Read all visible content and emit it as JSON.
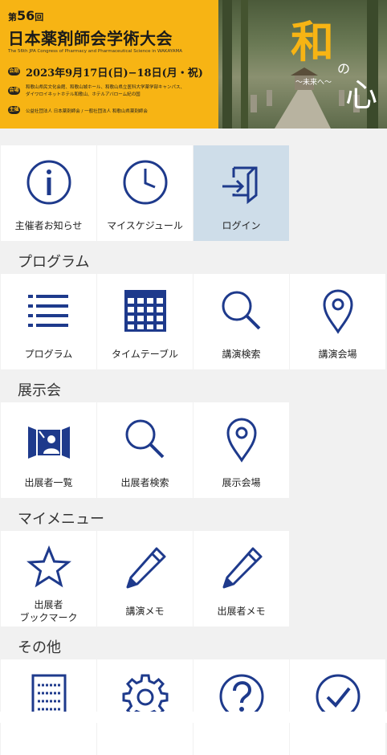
{
  "banner": {
    "edition_prefix": "第",
    "edition_number": "56",
    "edition_suffix": "回",
    "title": "日本薬剤師会学術大会",
    "subtitle": "The 56th JPA Congress of Pharmacy and Pharmaceutical Science in WAKAYAMA",
    "date_tag": "会期",
    "date": "2023年9月17日(日)−18日(月・祝)",
    "venue_tag": "会場",
    "venue_line1": "和歌山県民文化会館、和歌山城ホール、和歌山県立医科大学薬学部キャンパス、",
    "venue_line2": "ダイワロイネットホテル和歌山、ホテルアバローム紀の国",
    "host_tag": "主催",
    "host": "公益社団法人 日本薬剤師会 / 一般社団法人 和歌山県薬剤師会",
    "theme_wa": "和",
    "theme_no": "の",
    "theme_kokoro": "心",
    "theme_sub": "〜未来へ〜"
  },
  "top_tiles": [
    {
      "label": "主催者お知らせ",
      "icon": "info-icon"
    },
    {
      "label": "マイスケジュール",
      "icon": "clock-icon"
    },
    {
      "label": "ログイン",
      "icon": "login-icon"
    }
  ],
  "sections": {
    "program": "プログラム",
    "exhibition": "展示会",
    "mymenu": "マイメニュー",
    "other": "その他"
  },
  "program_tiles": [
    {
      "label": "プログラム",
      "icon": "list-icon"
    },
    {
      "label": "タイムテーブル",
      "icon": "calendar-icon"
    },
    {
      "label": "講演検索",
      "icon": "search-icon"
    },
    {
      "label": "講演会場",
      "icon": "location-pin-icon"
    }
  ],
  "exhibition_tiles": [
    {
      "label": "出展者一覧",
      "icon": "exhibitor-booth-icon"
    },
    {
      "label": "出展者検索",
      "icon": "search-icon"
    },
    {
      "label": "展示会場",
      "icon": "location-pin-icon"
    }
  ],
  "mymenu_tiles": [
    {
      "label_line1": "出展者",
      "label_line2": "ブックマーク",
      "icon": "star-icon"
    },
    {
      "label": "講演メモ",
      "icon": "pencil-icon"
    },
    {
      "label": "出展者メモ",
      "icon": "pencil-icon"
    }
  ],
  "other_tiles": [
    {
      "icon": "document-icon"
    },
    {
      "icon": "gear-icon"
    },
    {
      "icon": "help-icon"
    },
    {
      "icon": "check-icon"
    }
  ],
  "colors": {
    "icon_blue": "#1e3a8c",
    "banner_yellow": "#f7b414",
    "active_tile": "#cedde9"
  }
}
